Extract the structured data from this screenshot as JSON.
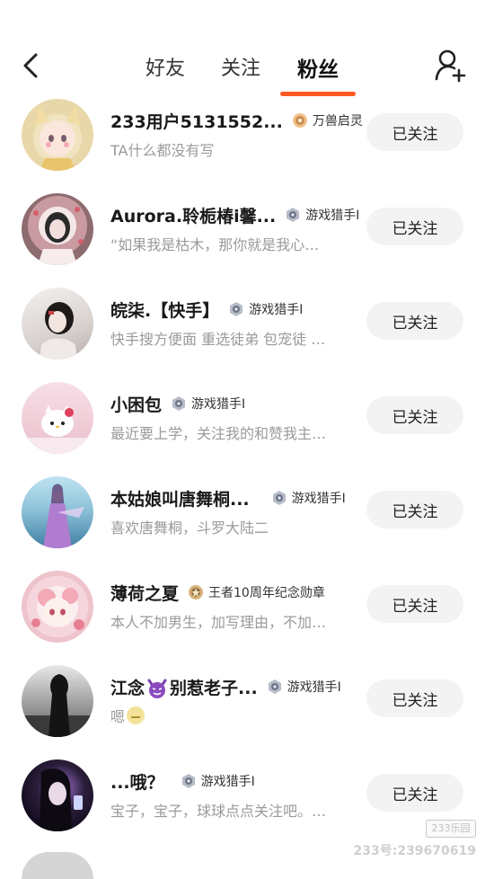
{
  "header": {
    "tabs": [
      {
        "label": "好友",
        "active": false
      },
      {
        "label": "关注",
        "active": false
      },
      {
        "label": "粉丝",
        "active": true
      }
    ],
    "accent_color": "#ff5a1f"
  },
  "fans": [
    {
      "name": "233用户5131552...",
      "badge": "万兽启灵",
      "badge_icon": "beast-badge-icon",
      "bio": "TA什么都没有写",
      "button": "已关注"
    },
    {
      "name": "Aurora.聆栀椿i馨...",
      "badge": "游戏猎手I",
      "badge_icon": "hunter-badge-icon",
      "bio": "“如果我是枯木，那你就是我心…",
      "button": "已关注"
    },
    {
      "name": "皖柒.【快手】",
      "badge": "游戏猎手I",
      "badge_icon": "hunter-badge-icon",
      "bio": "快手搜方便面 重选徒弟 包宠徒 …",
      "button": "已关注"
    },
    {
      "name": "小困包",
      "badge": "游戏猎手I",
      "badge_icon": "hunter-badge-icon",
      "bio": "最近要上学，关注我的和赞我主…",
      "button": "已关注"
    },
    {
      "name": "本姑娘叫唐舞桐...",
      "badge": "游戏猎手I",
      "badge_icon": "hunter-badge-icon",
      "bio": "喜欢唐舞桐，斗罗大陆二",
      "button": "已关注"
    },
    {
      "name": "薄荷之夏",
      "badge": "王者10周年纪念勋章",
      "badge_icon": "anniversary-badge-icon",
      "bio": "本人不加男生，加写理由，不加…",
      "button": "已关注"
    },
    {
      "name_prefix": "江念",
      "name_suffix": "别惹老子...",
      "badge": "游戏猎手I",
      "badge_icon": "hunter-badge-icon",
      "bio": "嗯",
      "button": "已关注"
    },
    {
      "name": "...哦？",
      "badge": "游戏猎手I",
      "badge_icon": "hunter-badge-icon",
      "bio": "宝子，宝子，球球点点关注吧。…",
      "button": "已关注"
    }
  ],
  "watermark": {
    "logo": "233乐园",
    "id_text": "233号:239670619"
  }
}
